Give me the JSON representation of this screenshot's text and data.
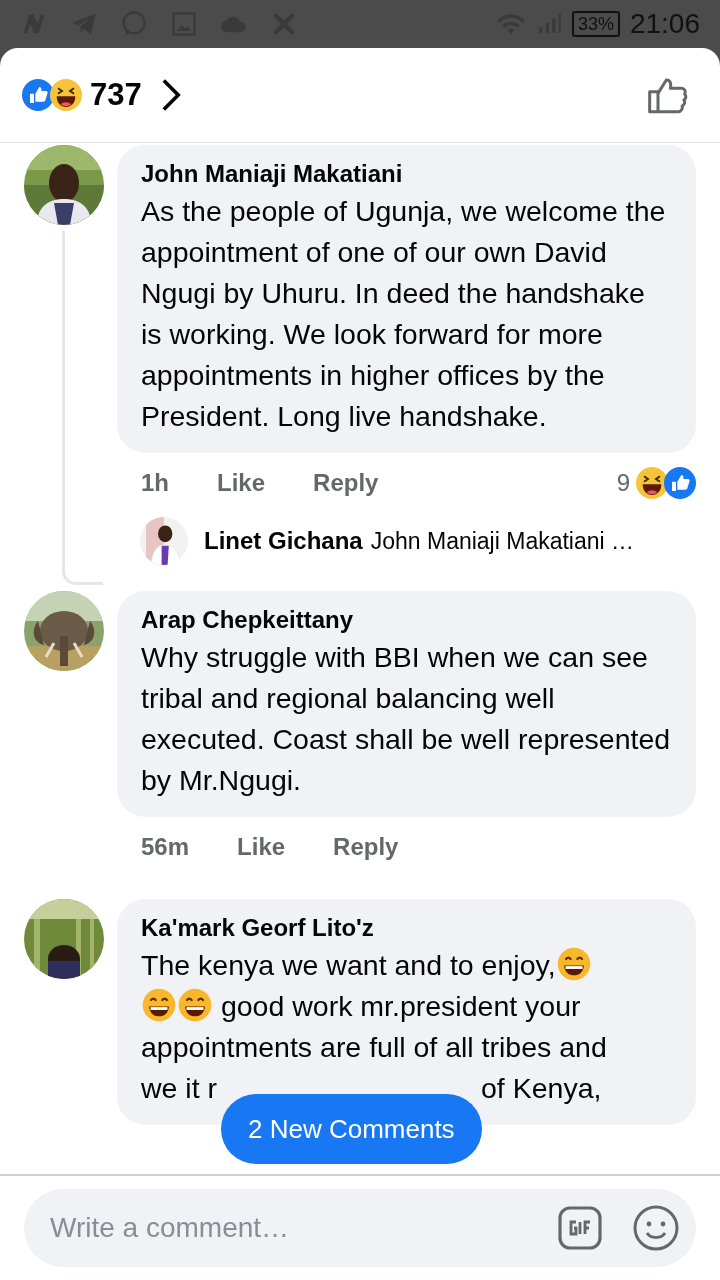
{
  "status_bar": {
    "battery": "33%",
    "time": "21:06"
  },
  "header": {
    "reaction_count": "737"
  },
  "comments": [
    {
      "author": "John Maniaji Makatiani",
      "segments": [
        {
          "kind": "text",
          "text": "As the people of Ugunja, we welcome the appointment of one of our own David Ngugi by Uhuru. In deed the handshake is working. We look forward for more appointments in higher offices by the President. Long live handshake."
        }
      ],
      "time": "1h",
      "like": "Like",
      "reply": "Reply",
      "reaction_count": "9",
      "replies": [
        {
          "author": "Linet Gichana",
          "preview": "John Maniaji Makatiani …"
        }
      ]
    },
    {
      "author": "Arap Chepkeittany",
      "segments": [
        {
          "kind": "text",
          "text": "Why struggle with BBI when we can see tribal and regional balancing well executed. Coast shall be well represented by Mr.Ngugi."
        }
      ],
      "time": "56m",
      "like": "Like",
      "reply": "Reply"
    },
    {
      "author": "Ka'mark Georf Lito'z",
      "segments": [
        {
          "kind": "text",
          "text": "The kenya we want and to enjoy,"
        },
        {
          "kind": "emoji"
        },
        {
          "kind": "break"
        },
        {
          "kind": "emoji"
        },
        {
          "kind": "emoji"
        },
        {
          "kind": "text",
          "text": " good work mr.president your"
        },
        {
          "kind": "break"
        },
        {
          "kind": "text",
          "text": "appointments are full of all tribes and"
        },
        {
          "kind": "break"
        },
        {
          "kind": "text",
          "text": "we it r"
        },
        {
          "kind": "gap"
        },
        {
          "kind": "text",
          "text": "of Kenya,"
        }
      ]
    }
  ],
  "new_comments_button": "2 New Comments",
  "composer": {
    "placeholder": "Write a comment…"
  }
}
